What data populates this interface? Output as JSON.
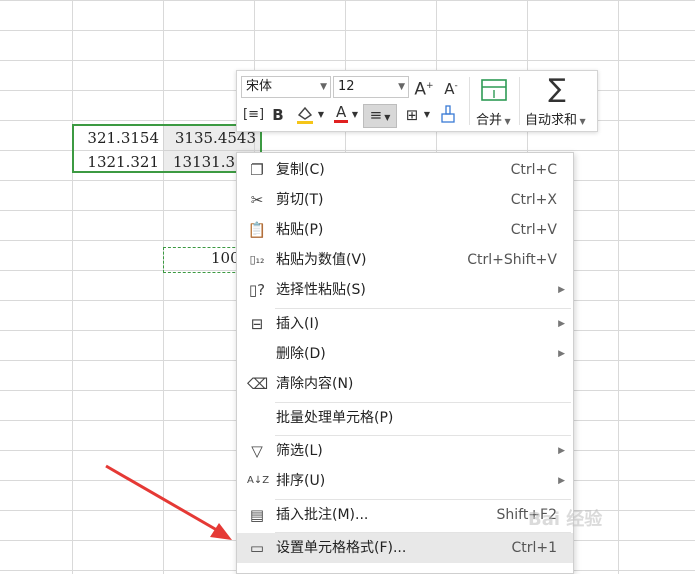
{
  "sheet": {
    "cells": [
      {
        "name": "cell-a1",
        "value": "321.3154"
      },
      {
        "name": "cell-b1",
        "value": "3135.4543"
      },
      {
        "name": "cell-a2",
        "value": "1321.321"
      },
      {
        "name": "cell-b2",
        "value": "13131.3"
      },
      {
        "name": "cell-copy",
        "value": "100"
      }
    ]
  },
  "toolbar": {
    "font_name": "宋体",
    "font_size": "12",
    "merge_label": "合并",
    "autosum_label": "自动求和"
  },
  "menu": {
    "items": [
      {
        "label": "复制(C)",
        "shortcut": "Ctrl+C",
        "icon": "copy-icon"
      },
      {
        "label": "剪切(T)",
        "shortcut": "Ctrl+X",
        "icon": "cut-icon"
      },
      {
        "label": "粘贴(P)",
        "shortcut": "Ctrl+V",
        "icon": "paste-icon"
      },
      {
        "label": "粘贴为数值(V)",
        "shortcut": "Ctrl+Shift+V",
        "icon": "paste-values-icon"
      },
      {
        "label": "选择性粘贴(S)",
        "shortcut": "",
        "icon": "paste-special-icon"
      },
      {
        "label": "插入(I)",
        "shortcut": "",
        "icon": "insert-icon"
      },
      {
        "label": "删除(D)",
        "shortcut": "",
        "icon": ""
      },
      {
        "label": "清除内容(N)",
        "shortcut": "",
        "icon": "clear-icon"
      },
      {
        "label": "批量处理单元格(P)",
        "shortcut": "",
        "icon": ""
      },
      {
        "label": "筛选(L)",
        "shortcut": "",
        "icon": "filter-icon"
      },
      {
        "label": "排序(U)",
        "shortcut": "",
        "icon": "sort-icon"
      },
      {
        "label": "插入批注(M)...",
        "shortcut": "Shift+F2",
        "icon": "comment-icon"
      },
      {
        "label": "设置单元格格式(F)...",
        "shortcut": "Ctrl+1",
        "icon": "format-cells-icon"
      }
    ]
  },
  "watermark": "Bai 经验",
  "colors": {
    "selection_border": "#3c9a42",
    "arrow": "#e53935",
    "highlight": "#e8e8e8"
  }
}
